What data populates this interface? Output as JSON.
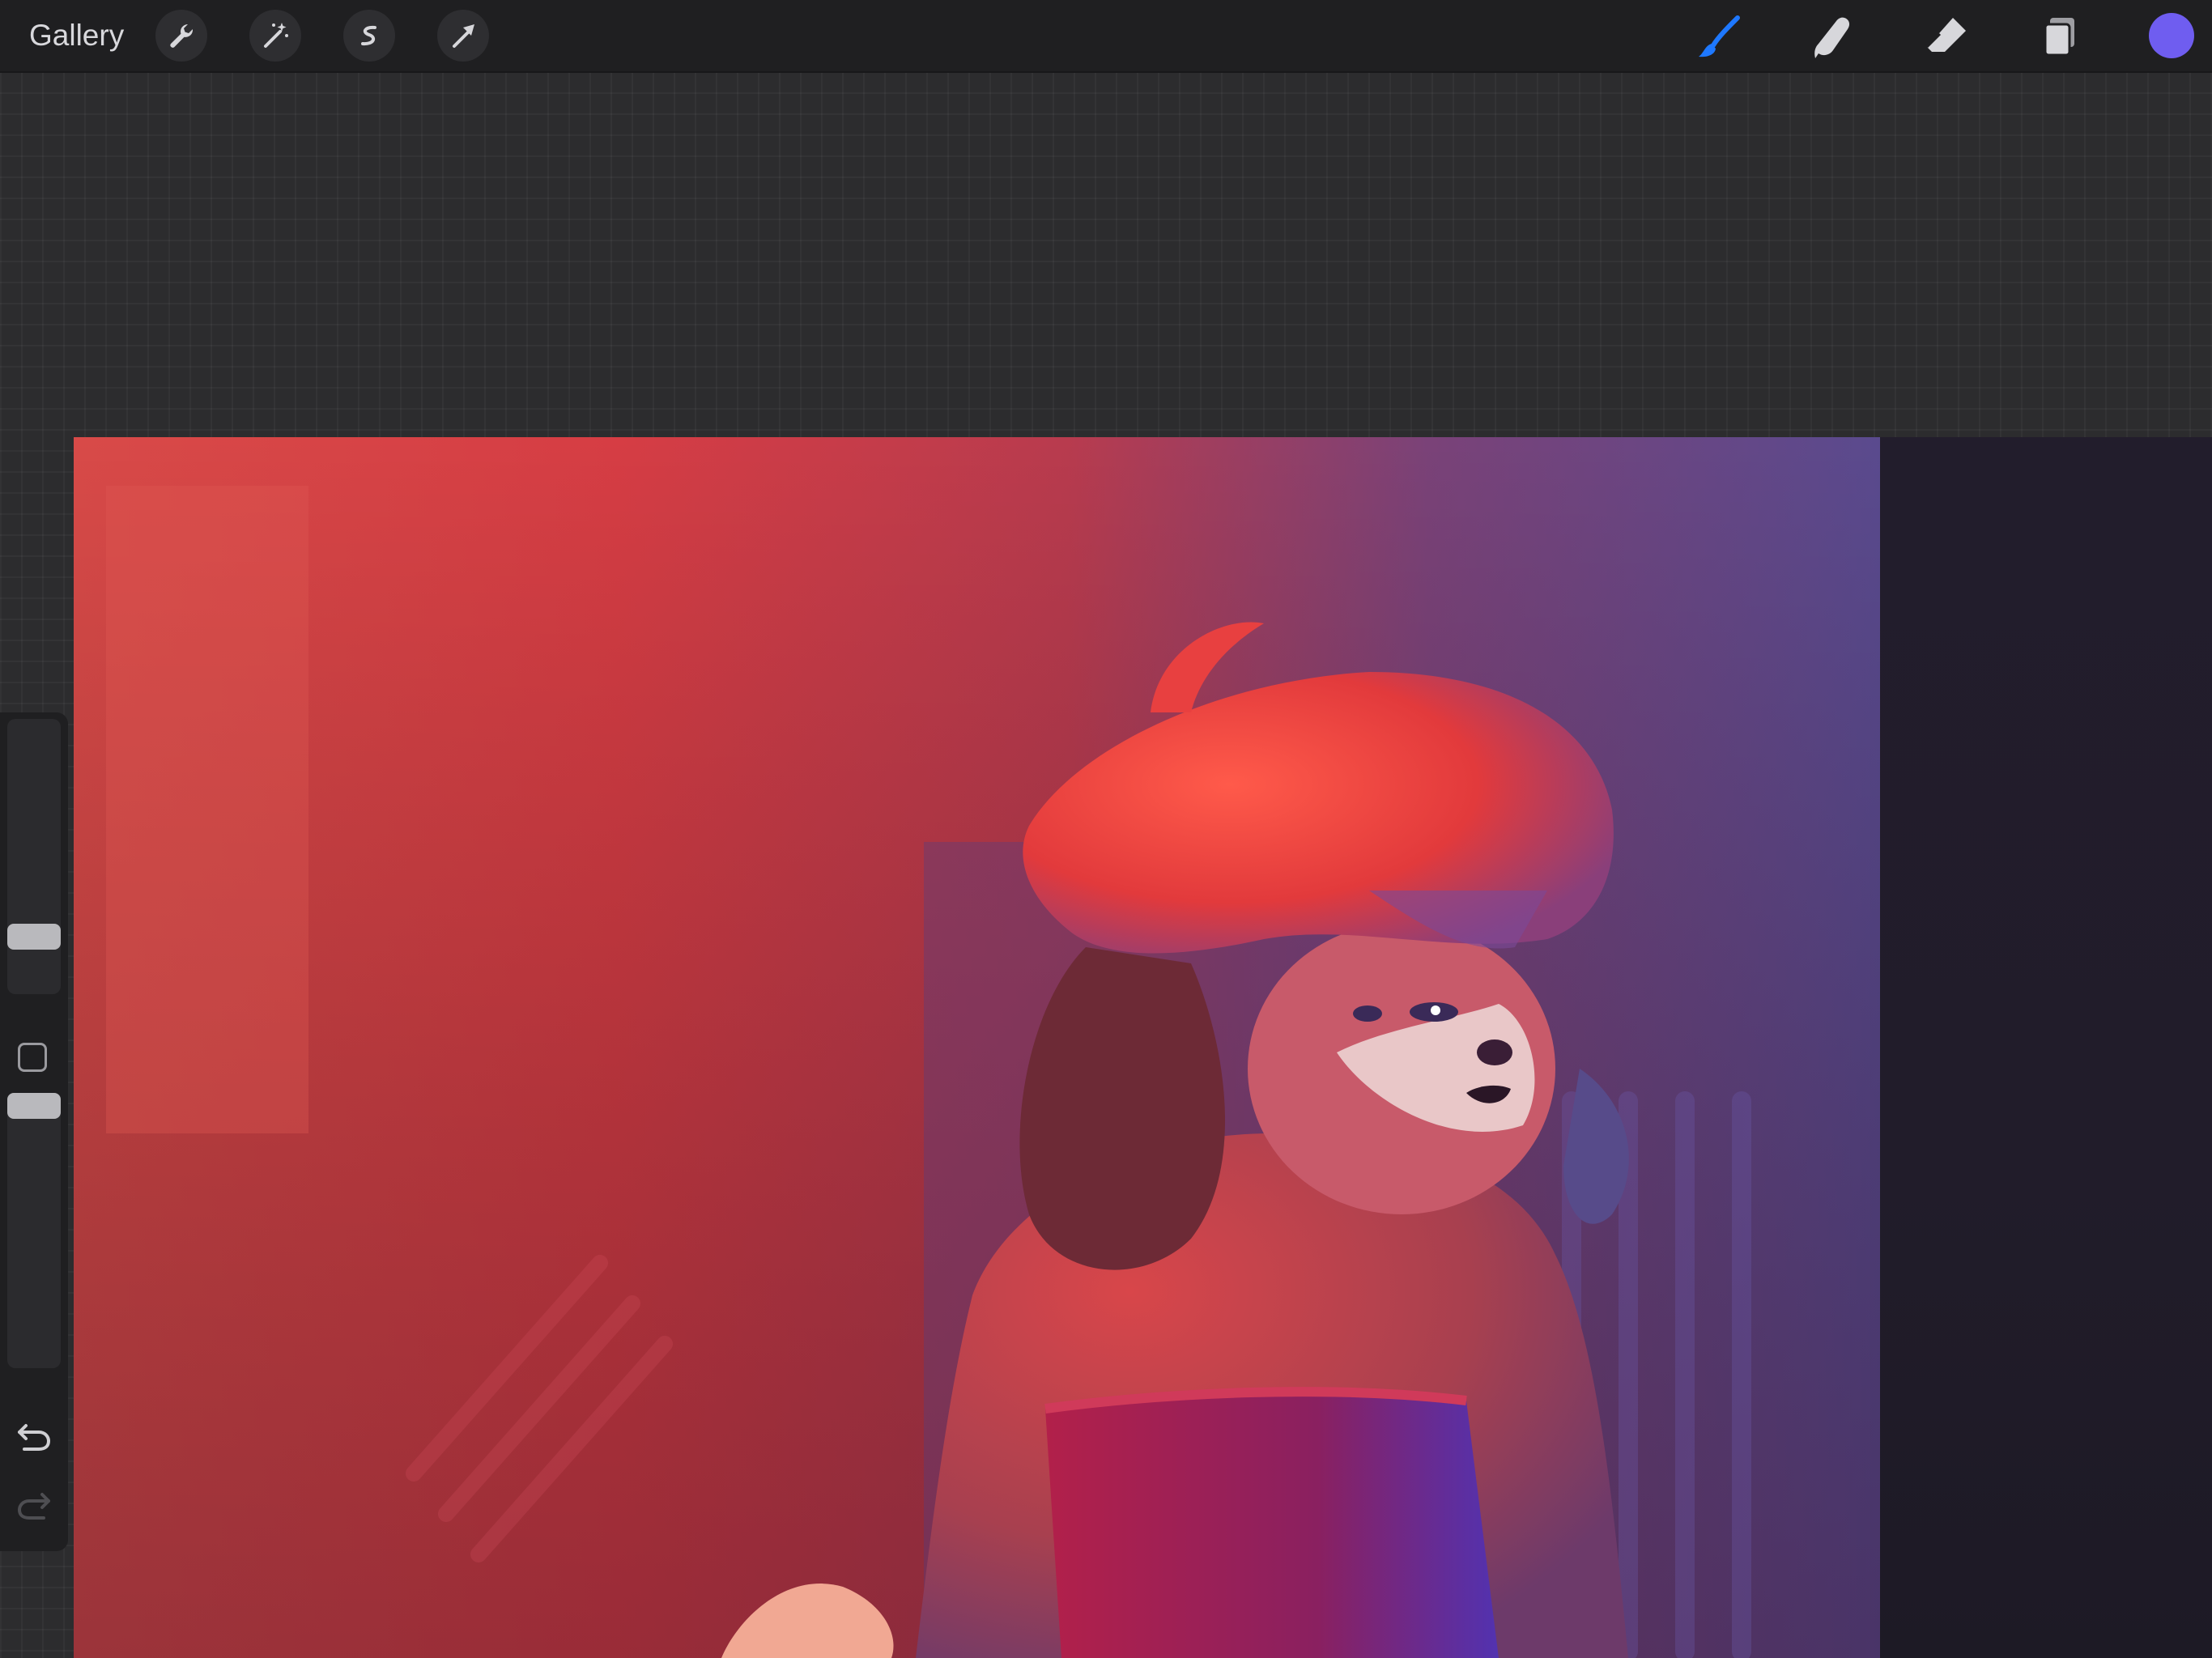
{
  "toolbar": {
    "gallery_label": "Gallery",
    "left_tools": [
      {
        "name": "actions",
        "icon": "wrench-icon"
      },
      {
        "name": "adjustments",
        "icon": "magic-wand-icon"
      },
      {
        "name": "selection",
        "icon": "selection-s-icon"
      },
      {
        "name": "transform",
        "icon": "arrow-cursor-icon"
      }
    ],
    "right_tools": [
      {
        "name": "brush",
        "icon": "brush-icon",
        "active": true
      },
      {
        "name": "smudge",
        "icon": "smudge-finger-icon",
        "active": false
      },
      {
        "name": "eraser",
        "icon": "eraser-icon",
        "active": false
      },
      {
        "name": "layers",
        "icon": "layers-icon",
        "active": false
      }
    ],
    "current_color": "#6f5df0",
    "active_tool_color": "#1e78ff"
  },
  "sidebar": {
    "brush_size_level": 0.18,
    "opacity_level": 1.0,
    "undo_icon": "undo-icon",
    "redo_icon": "redo-icon"
  },
  "canvas": {
    "subject": "artwork",
    "palette": [
      "#d8403f",
      "#c43645",
      "#8a3a66",
      "#5a4690",
      "#221d2c"
    ]
  }
}
